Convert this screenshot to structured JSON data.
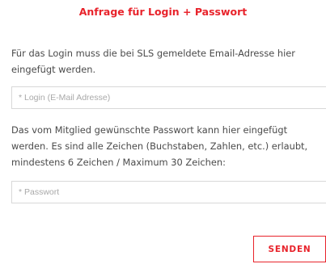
{
  "form": {
    "title": "Anfrage für Login + Passwort",
    "login_hint": "Für das Login muss die bei SLS gemeldete Email-Adresse hier eingefügt werden.",
    "login_placeholder": "* Login (E-Mail Adresse)",
    "login_value": "",
    "password_hint": "Das vom Mitglied gewünschte Passwort kann hier eingefügt werden. Es sind alle Zeichen (Buchstaben, Zahlen, etc.) erlaubt, mindestens 6 Zeichen / Maximum 30 Zeichen:",
    "password_placeholder": "* Passwort",
    "password_value": "",
    "submit_label": "SENDEN"
  },
  "colors": {
    "accent": "#e8232b",
    "text": "#4a4a4a",
    "placeholder": "#a9a9a9",
    "border": "#d8d8d8"
  }
}
